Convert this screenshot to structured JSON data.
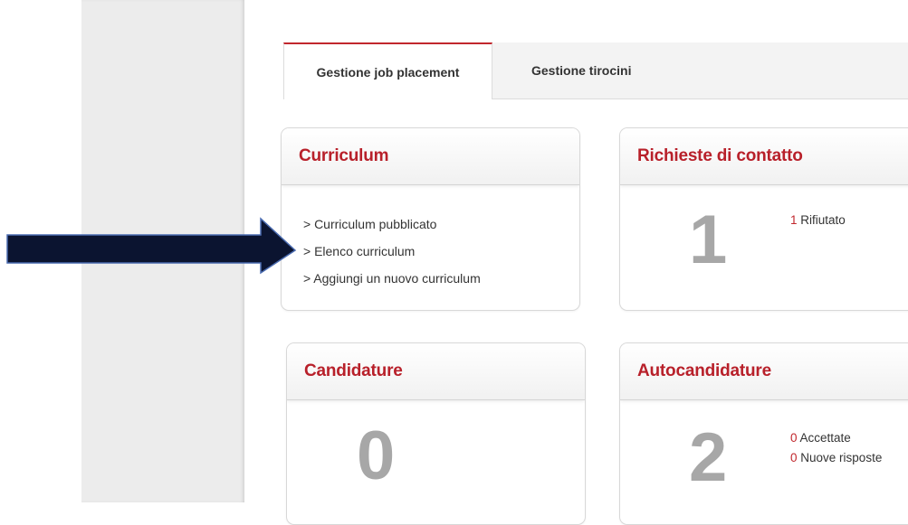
{
  "tabs": [
    {
      "label": "Gestione job placement",
      "active": true
    },
    {
      "label": "Gestione tirocini",
      "active": false
    }
  ],
  "cards": {
    "curriculum": {
      "title": "Curriculum",
      "links": [
        "> Curriculum pubblicato",
        "> Elenco curriculum",
        "> Aggiungi un nuovo curriculum"
      ]
    },
    "richieste": {
      "title": "Richieste di contatto",
      "count": "1",
      "stats": [
        {
          "value": "1",
          "label": "Rifiutato"
        }
      ]
    },
    "candidature": {
      "title": "Candidature",
      "count": "0"
    },
    "autocandidature": {
      "title": "Autocandidature",
      "count": "2",
      "stats": [
        {
          "value": "0",
          "label": "Accettate"
        },
        {
          "value": "0",
          "label": "Nuove risposte"
        }
      ]
    }
  },
  "colors": {
    "accent": "#c1272d",
    "number": "#a7a7a7",
    "sidebar": "#ececec",
    "arrow": "#0b1430"
  },
  "annotation": {
    "icon": "right-arrow-icon"
  }
}
